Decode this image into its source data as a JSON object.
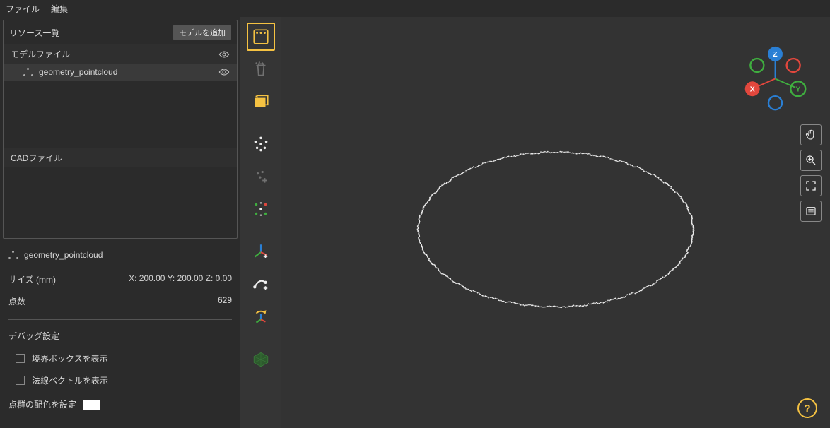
{
  "menubar": {
    "file": "ファイル",
    "edit": "編集"
  },
  "sidebar": {
    "resource_list_title": "リソース一覧",
    "add_model_btn": "モデルを追加",
    "model_files_label": "モデルファイル",
    "items": [
      {
        "name": "geometry_pointcloud"
      }
    ],
    "cad_files_label": "CADファイル"
  },
  "info": {
    "title": "geometry_pointcloud",
    "size_label": "サイズ (mm)",
    "size_value": "X: 200.00 Y: 200.00 Z: 0.00",
    "count_label": "点数",
    "count_value": "629",
    "debug_title": "デバッグ設定",
    "bbox_label": "境界ボックスを表示",
    "normals_label": "法線ベクトルを表示",
    "color_label": "点群の配色を設定"
  },
  "colors": {
    "accent": "#f5c242",
    "x": "#e2473d",
    "y": "#3fae3f",
    "z": "#2a7fd4"
  },
  "gizmo": {
    "x": "X",
    "y": "Y",
    "z": "Z"
  },
  "help": "?"
}
